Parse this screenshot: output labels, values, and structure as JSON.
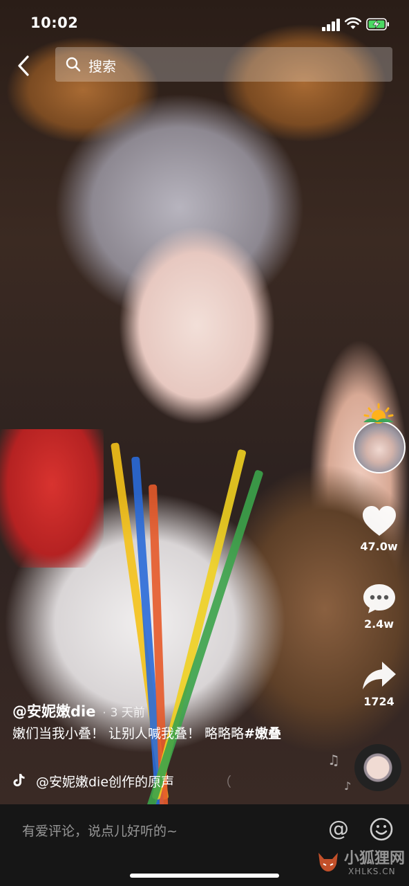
{
  "status_bar": {
    "time": "10:02"
  },
  "top_bar": {
    "search_placeholder": "搜索"
  },
  "actions": {
    "like_count": "47.0w",
    "comment_count": "2.4w",
    "share_count": "1724"
  },
  "caption": {
    "author": "@安妮嫩die",
    "separator": "·",
    "time_ago": "3 天前",
    "text": "嫩们当我小叠！ 让别人喊我叠！ 略略略",
    "hashtag": "#嫩叠"
  },
  "music": {
    "title": "@安妮嫩die创作的原声",
    "scroll_tail": "（"
  },
  "bottom_bar": {
    "comment_placeholder": "有爱评论，说点儿好听的~"
  },
  "watermark": {
    "name_cn": "小狐狸网",
    "domain": "XHLKS.CN"
  },
  "icons": {
    "back": "chevron-left-icon",
    "search": "search-icon",
    "like": "heart-icon",
    "comment": "comment-bubble-icon",
    "share": "share-arrow-icon",
    "music": "tiktok-note-icon",
    "at": "at-icon",
    "emoji": "smiley-icon"
  }
}
